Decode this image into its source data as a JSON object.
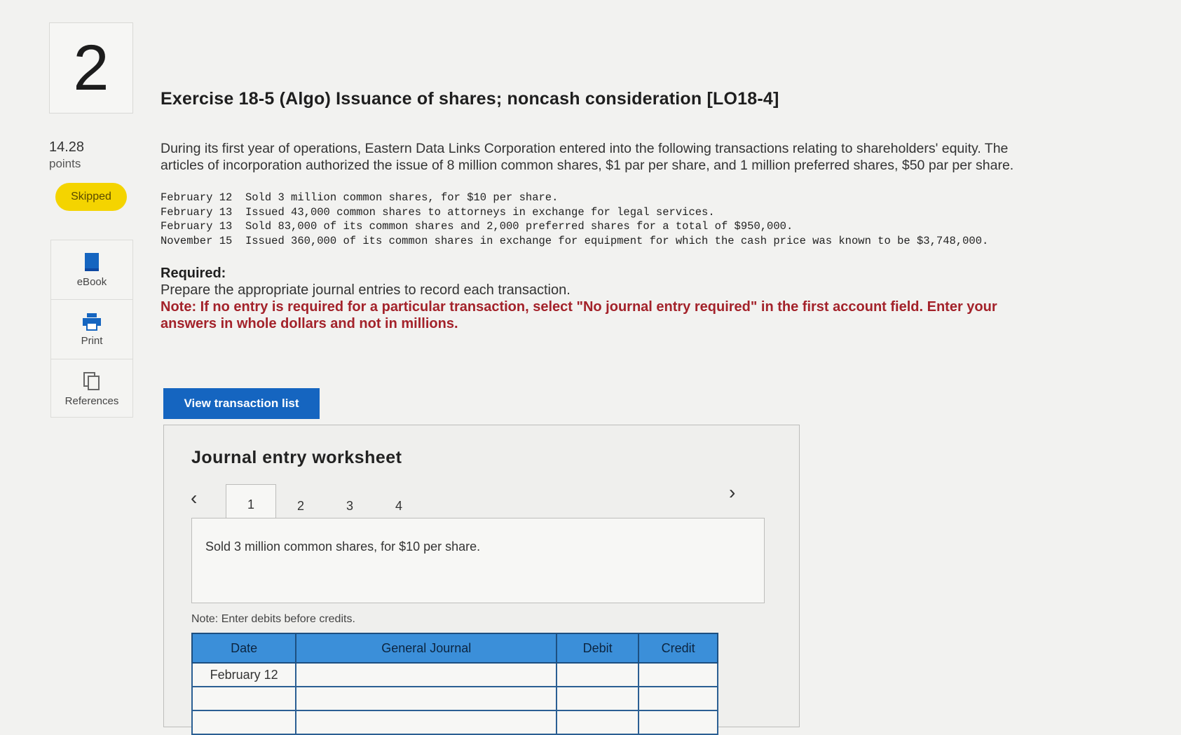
{
  "question": {
    "number": "2",
    "points_value": "14.28",
    "points_label": "points",
    "status": "Skipped"
  },
  "tools": [
    {
      "label": "eBook",
      "icon": "ebook-icon"
    },
    {
      "label": "Print",
      "icon": "print-icon"
    },
    {
      "label": "References",
      "icon": "references-icon"
    }
  ],
  "exercise": {
    "title": "Exercise 18-5 (Algo) Issuance of shares; noncash consideration [LO18-4]",
    "intro": "During its first year of operations, Eastern Data Links Corporation entered into the following transactions relating to shareholders' equity. The articles of incorporation authorized the issue of 8 million common shares, $1 par per share, and 1 million preferred shares, $50 par per share.",
    "transactions": [
      {
        "date": "February 12",
        "text": "Sold 3 million common shares, for $10 per share."
      },
      {
        "date": "February 13",
        "text": "Issued 43,000 common shares to attorneys in exchange for legal services."
      },
      {
        "date": "February 13",
        "text": "Sold 83,000 of its common shares and 2,000 preferred shares for a total of $950,000."
      },
      {
        "date": "November 15",
        "text": "Issued 360,000 of its common shares in exchange for equipment for which the cash price was known to be $3,748,000."
      }
    ],
    "required_heading": "Required:",
    "required_text": "Prepare the appropriate journal entries to record each transaction.",
    "note": "Note: If no entry is required for a particular transaction, select \"No journal entry required\" in the first account field. Enter your answers in whole dollars and not in millions."
  },
  "view_button": "View transaction list",
  "worksheet": {
    "title": "Journal entry worksheet",
    "tabs": [
      "1",
      "2",
      "3",
      "4"
    ],
    "active_tab": "1",
    "description": "Sold 3 million common shares, for $10 per share.",
    "note": "Note: Enter debits before credits.",
    "columns": [
      "Date",
      "General Journal",
      "Debit",
      "Credit"
    ],
    "rows": [
      {
        "date": "February 12",
        "account": "",
        "debit": "",
        "credit": ""
      },
      {
        "date": "",
        "account": "",
        "debit": "",
        "credit": ""
      },
      {
        "date": "",
        "account": "",
        "debit": "",
        "credit": ""
      }
    ]
  }
}
